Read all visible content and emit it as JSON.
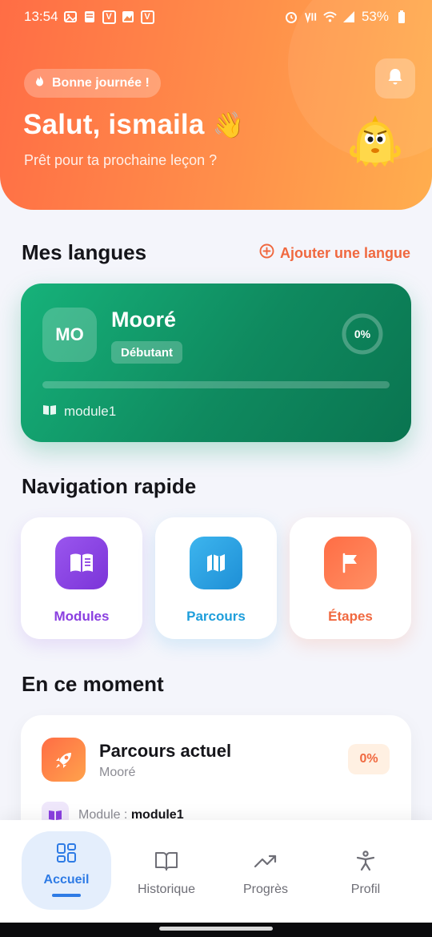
{
  "status_bar": {
    "time": "13:54",
    "battery": "53%",
    "left_icons": [
      "image-icon",
      "note-icon",
      "v-app-icon",
      "gallery-icon",
      "v-app-icon"
    ],
    "right_icons": [
      "alarm-icon",
      "volte-icon",
      "wifi-icon",
      "signal-icon",
      "battery-icon"
    ]
  },
  "header": {
    "chip_label": "Bonne journée !",
    "title": "Salut, ismaila",
    "wave_emoji": "👋",
    "subtitle": "Prêt pour ta prochaine leçon ?",
    "icons": [
      "fire-icon",
      "bell-icon",
      "mascot-icon"
    ],
    "colors": {
      "gradient_start": "#ff6d45",
      "gradient_end": "#ffae4e"
    }
  },
  "languages": {
    "section_title": "Mes langues",
    "add_label": "Ajouter une langue",
    "card": {
      "badge": "MO",
      "name": "Mooré",
      "level": "Débutant",
      "progress_label": "0%",
      "progress": 0,
      "module_label": "module1",
      "color": "#16b27a"
    }
  },
  "quick_nav": {
    "section_title": "Navigation rapide",
    "items": [
      {
        "label": "Modules",
        "icon": "book-icon",
        "color": "#8a3fe0"
      },
      {
        "label": "Parcours",
        "icon": "map-icon",
        "color": "#1e9edb"
      },
      {
        "label": "Étapes",
        "icon": "flag-icon",
        "color": "#f0683f"
      }
    ]
  },
  "current": {
    "section_title": "En ce moment",
    "title": "Parcours actuel",
    "subtitle": "Mooré",
    "percent": "0%",
    "module_prefix": "Module : ",
    "module_name": "module1",
    "icon": "rocket-icon"
  },
  "bottom_nav": {
    "items": [
      {
        "label": "Accueil",
        "icon": "grid-icon",
        "active": true
      },
      {
        "label": "Historique",
        "icon": "open-book-icon",
        "active": false
      },
      {
        "label": "Progrès",
        "icon": "trending-up-icon",
        "active": false
      },
      {
        "label": "Profil",
        "icon": "person-icon",
        "active": false
      }
    ],
    "active_color": "#2e7be5"
  }
}
